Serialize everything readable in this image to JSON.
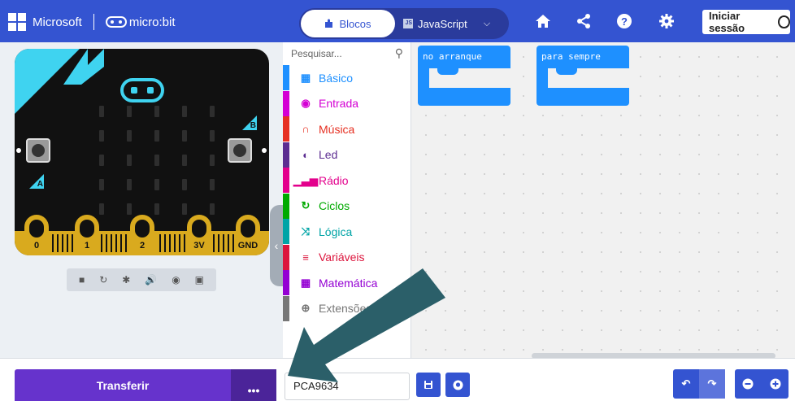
{
  "header": {
    "brand_microsoft": "Microsoft",
    "brand_microbit": "micro:bit",
    "tab_blocks": "Blocos",
    "tab_js": "JavaScript",
    "sign_in": "Iniciar sessão",
    "icons": [
      "home-icon",
      "share-icon",
      "help-icon",
      "settings-icon"
    ]
  },
  "simulator": {
    "pins": [
      "0",
      "1",
      "2",
      "3V",
      "GND"
    ],
    "label_a": "A",
    "label_b": "B",
    "toolbar_icons": [
      "stop-icon",
      "restart-icon",
      "debug-icon",
      "mute-icon",
      "screenshot-icon",
      "fullscreen-icon"
    ]
  },
  "toolbox": {
    "search_placeholder": "Pesquisar...",
    "categories": [
      {
        "label": "Básico",
        "color": "#1e90ff",
        "icon": "grid-icon"
      },
      {
        "label": "Entrada",
        "color": "#d400d4",
        "icon": "input-icon"
      },
      {
        "label": "Música",
        "color": "#e63022",
        "icon": "headphones-icon"
      },
      {
        "label": "Led",
        "color": "#5c2d91",
        "icon": "toggle-icon"
      },
      {
        "label": "Rádio",
        "color": "#e3008c",
        "icon": "signal-icon"
      },
      {
        "label": "Ciclos",
        "color": "#00aa00",
        "icon": "loop-icon"
      },
      {
        "label": "Lógica",
        "color": "#00a4a6",
        "icon": "shuffle-icon"
      },
      {
        "label": "Variáveis",
        "color": "#dc143c",
        "icon": "list-icon"
      },
      {
        "label": "Matemática",
        "color": "#9400d3",
        "icon": "calculator-icon"
      },
      {
        "label": "Extensões",
        "color": "#777777",
        "icon": "plus-circle-icon"
      }
    ]
  },
  "workspace": {
    "block_start": "no arranque",
    "block_forever": "para sempre"
  },
  "bottom": {
    "download": "Transferir",
    "more": "•••",
    "project_name": "PCA9634"
  },
  "colors": {
    "header": "#3454d1",
    "download": "#6633cc",
    "arrow": "#2b5f69"
  }
}
